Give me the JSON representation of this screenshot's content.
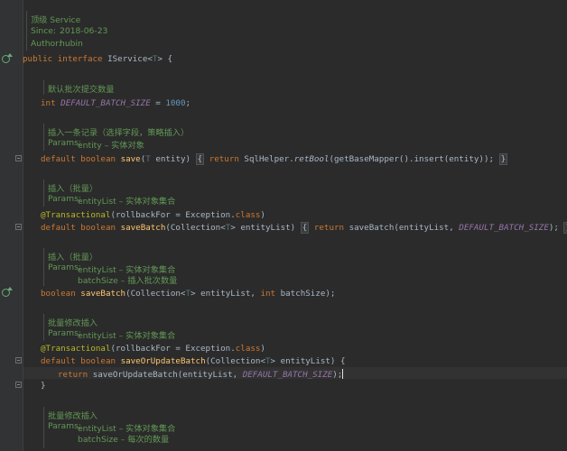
{
  "header_doc": {
    "line1": "顶级 Service",
    "since_label": "Since:",
    "since_value": "2018-06-23",
    "author_label": "Author:",
    "author_value": "hubin"
  },
  "line_interface": {
    "kw1": "public",
    "kw2": "interface",
    "name": "IService<",
    "tparam": "T",
    "tail": "> {"
  },
  "doc_batch_size": {
    "line1": "默认批次提交数量"
  },
  "line_batch_size": {
    "type": "int",
    "field": "DEFAULT_BATCH_SIZE",
    "eq": " = ",
    "value": "1000",
    "end": ";"
  },
  "doc_save": {
    "line1": "插入一条记录（选择字段，策略插入）",
    "params_label": "Params:",
    "params_value": "entity – 实体对象"
  },
  "line_save": {
    "kw1": "default",
    "kw2": "boolean",
    "method": "save",
    "open": "(",
    "tparam": "T",
    "arg": " entity) ",
    "fold_open": "{",
    "kw_return": "return",
    "helper": " SqlHelper.",
    "helper_method": "retBool",
    "call": "(getBaseMapper().insert(entity)); ",
    "fold_close": "}"
  },
  "doc_save_batch": {
    "line1": "插入（批量）",
    "params_label": "Params:",
    "params_value": "entityList – 实体对象集合"
  },
  "line_annotation1": {
    "ann": "@Transactional",
    "args": "(rollbackFor = Exception.",
    "kw_class": "class",
    "close": ")"
  },
  "line_save_batch": {
    "kw1": "default",
    "kw2": "boolean",
    "method": "saveBatch",
    "open": "(Collection<",
    "tparam": "T",
    "arg": "> entityList) ",
    "fold_open": "{",
    "kw_return": "return",
    "call": " saveBatch(entityList, ",
    "const": "DEFAULT_BATCH_SIZE",
    "end": "); ",
    "fold_close": "}"
  },
  "doc_save_batch2": {
    "line1": "插入（批量）",
    "params_label": "Params:",
    "params_value1": "entityList – 实体对象集合",
    "params_value2": "batchSize – 插入批次数量"
  },
  "line_save_batch2": {
    "kw1": "boolean",
    "method": "saveBatch",
    "open": "(Collection<",
    "tparam": "T",
    "arg": "> entityList, ",
    "kw_int": "int",
    "arg2": " batchSize);"
  },
  "doc_update_batch": {
    "line1": "批量修改插入",
    "params_label": "Params:",
    "params_value": "entityList – 实体对象集合"
  },
  "line_annotation2": {
    "ann": "@Transactional",
    "args": "(rollbackFor = Exception.",
    "kw_class": "class",
    "close": ")"
  },
  "line_update_batch": {
    "kw1": "default",
    "kw2": "boolean",
    "method": "saveOrUpdateBatch",
    "open": "(Collection<",
    "tparam": "T",
    "arg": "> entityList) {"
  },
  "line_update_return": {
    "kw_return": "return",
    "call": " saveOrUpdateBatch(entityList, ",
    "const": "DEFAULT_BATCH_SIZE",
    "end": ");"
  },
  "line_close_brace": {
    "text": "}"
  },
  "doc_update_batch2": {
    "line1": "批量修改插入",
    "params_label": "Params:",
    "params_value1": "entityList – 实体对象集合",
    "params_value2": "batchSize – 每次的数量"
  }
}
